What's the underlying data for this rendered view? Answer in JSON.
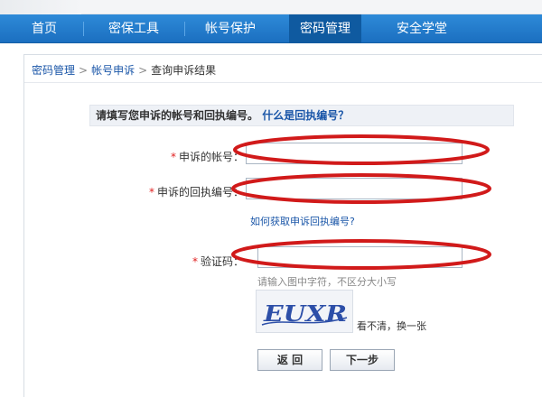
{
  "nav": {
    "items": [
      {
        "label": "首页"
      },
      {
        "label": "密保工具"
      },
      {
        "label": "帐号保护"
      },
      {
        "label": "密码管理"
      },
      {
        "label": "安全学堂"
      }
    ],
    "active_index": 3
  },
  "breadcrumb": {
    "items": [
      "密码管理",
      "帐号申诉",
      "查询申诉结果"
    ],
    "separator": ">"
  },
  "notice": {
    "text": "请填写您申诉的帐号和回执编号。",
    "link": "什么是回执编号？"
  },
  "form": {
    "required_mark": "*",
    "account_label": "申诉的帐号：",
    "account_value": "",
    "receipt_label": "申诉的回执编号：",
    "receipt_value": "",
    "receipt_help_link": "如何获取申诉回执编号?",
    "captcha_label": "验证码：",
    "captcha_value": "",
    "captcha_hint": "请输入图中字符，不区分大小写",
    "captcha_text": "EUXR",
    "refresh_link": "看不清，换一张"
  },
  "buttons": {
    "back": "返 回",
    "next": "下一步"
  },
  "colors": {
    "nav_bg": "#1b6fc0",
    "nav_active": "#0f5aa0",
    "link": "#1a56a8",
    "required": "#e02020",
    "annotation": "#d11a1a"
  }
}
